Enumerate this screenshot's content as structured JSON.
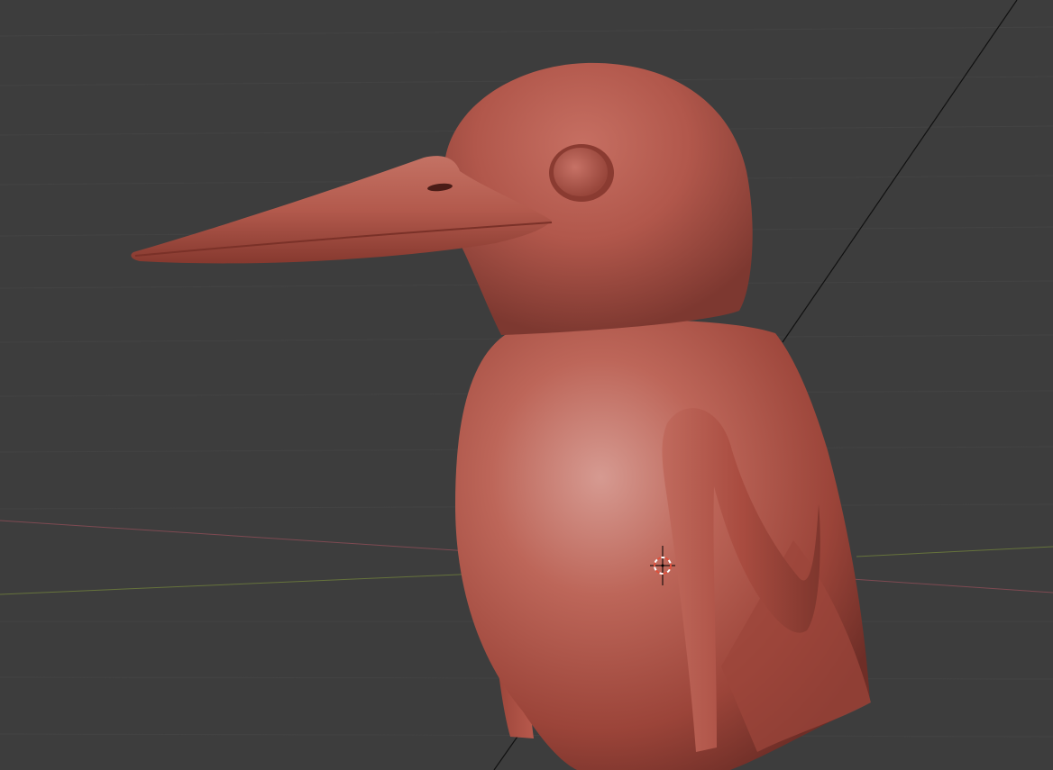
{
  "viewport": {
    "mode": "3d-sculpt-viewport",
    "background_color": "#3d3d3d",
    "grid_color": "#444444",
    "x_axis_color": "#8a4a52",
    "y_axis_color": "#6d7a40",
    "z_axis_color": "#111111"
  },
  "model": {
    "subject": "kingfisher-bird-sculpt",
    "material_color": "#b5574b",
    "material_highlight": "#d8938a",
    "material_shadow": "#6e2e27"
  },
  "cursor_3d": {
    "icon": "3d-cursor-icon",
    "ring_color_a": "#e0503c",
    "ring_color_b": "#ffffff"
  }
}
